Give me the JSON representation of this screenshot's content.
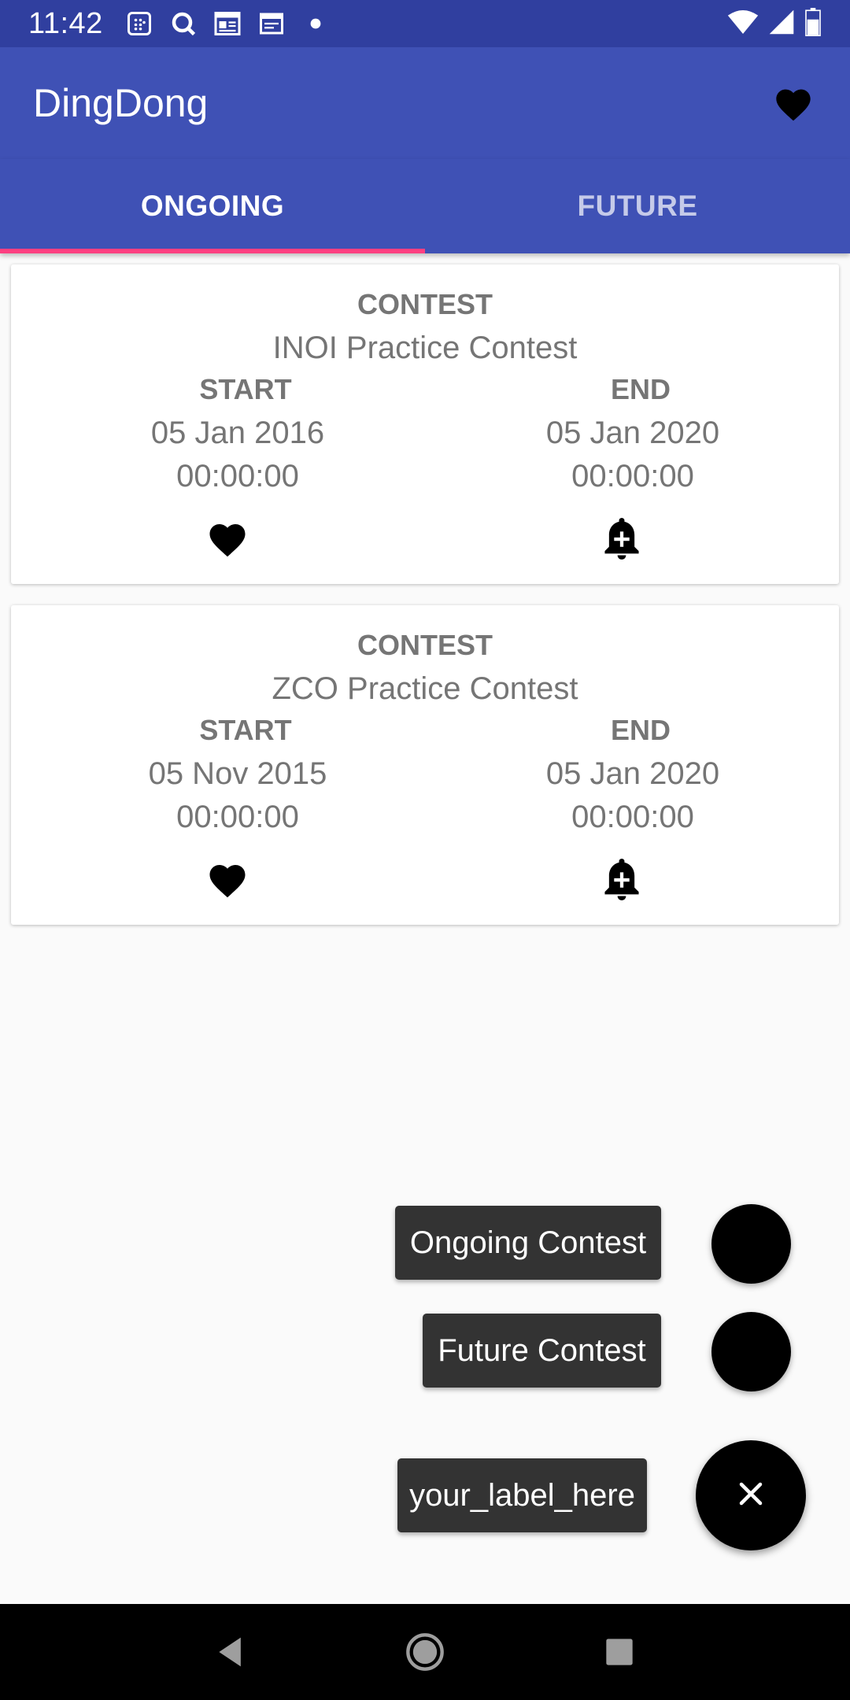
{
  "status_bar": {
    "time": "11:42",
    "icons": [
      "calculator-icon",
      "q-icon",
      "newspaper-icon",
      "calendar-icon",
      "dot-icon",
      "wifi-icon",
      "signal-icon",
      "battery-icon"
    ]
  },
  "app_bar": {
    "title": "DingDong",
    "action_icon": "heart-icon"
  },
  "tabs": [
    {
      "label": "ONGOING",
      "active": true
    },
    {
      "label": "FUTURE",
      "active": false
    }
  ],
  "contests": [
    {
      "label": "CONTEST",
      "name": "INOI Practice Contest",
      "start_label": "START",
      "start_date": "05 Jan 2016",
      "start_time": "00:00:00",
      "end_label": "END",
      "end_date": "05 Jan 2020",
      "end_time": "00:00:00"
    },
    {
      "label": "CONTEST",
      "name": "ZCO Practice Contest",
      "start_label": "START",
      "start_date": "05 Nov 2015",
      "start_time": "00:00:00",
      "end_label": "END",
      "end_date": "05 Jan 2020",
      "end_time": "00:00:00"
    }
  ],
  "fab_menu": {
    "items": [
      {
        "label": "Ongoing Contest"
      },
      {
        "label": "Future Contest"
      }
    ],
    "main_label": "your_label_here",
    "main_icon": "close-icon"
  },
  "nav_bar": {
    "icons": [
      "back-icon",
      "home-icon",
      "recents-icon"
    ]
  },
  "colors": {
    "status_bar": "#303f9f",
    "primary": "#3f51b5",
    "accent": "#ff4081",
    "card_text": "#757575",
    "fab": "#000000",
    "fab_label": "#333333"
  }
}
